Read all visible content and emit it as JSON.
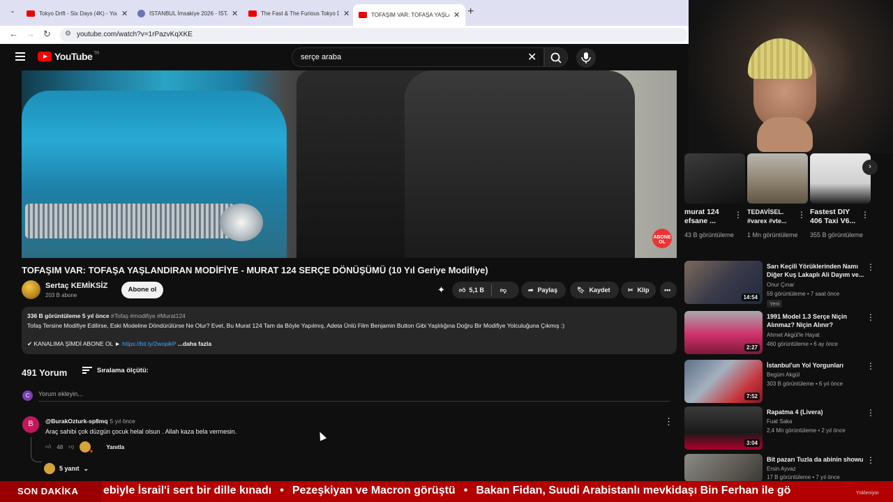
{
  "browser": {
    "tabs": [
      {
        "title": "Tokyo Drift - Six Days (4K) - You",
        "active": false
      },
      {
        "title": "İSTANBUL İmsakiye 2026 - İSTA",
        "active": false
      },
      {
        "title": "The Fast & The Furious Tokyo D",
        "active": false
      },
      {
        "title": "TOFAŞIM VAR: TOFAŞA YAŞLAN",
        "active": true
      }
    ],
    "url": "youtube.com/watch?v=1rPazvKqXKE"
  },
  "header": {
    "logo_text": "YouTube",
    "region": "TR",
    "search_value": "serçe araba"
  },
  "video": {
    "title": "TOFAŞIM VAR: TOFAŞA YAŞLANDIRAN MODİFİYE - MURAT 124 SERÇE DÖNÜŞÜMÜ (10 Yıl Geriye Modifiye)",
    "overlay_badge": "ABONE OL",
    "channel_name": "Sertaç KEMİKSİZ",
    "subscribers": "203 B abone",
    "subscribe_label": "Abone ol",
    "likes": "5,1 B",
    "share_label": "Paylaş",
    "save_label": "Kaydet",
    "clip_label": "Klip"
  },
  "description": {
    "views_time": "336 B görüntüleme  5 yıl önce",
    "tags": "#Tofaş #modifiye #Murat124",
    "line1": "Tofaş Tersine Modifiye Edilirse, Eski Modeline Döndürülürse Ne Olur? Evet, Bu Murat 124 Tam da Böyle Yapılmış, Adeta Ünlü Film Benjamin Button Gibi Yaşlılığına Doğru Bir Modifiye Yolculuğuna Çıkmış :)",
    "line2_prefix": "✔ KANALIMA ŞİMDİ ABONE OL ►",
    "line2_link": "https://bit.ly/2wopikP",
    "more_label": "...daha fazla"
  },
  "comments": {
    "count": "491 Yorum",
    "sort_label": "Sıralama ölçütü:",
    "my_initial": "C",
    "add_placeholder": "Yorum ekleyin...",
    "items": [
      {
        "initial": "B",
        "author": "@BurakOzturk-sp8mq",
        "time": "5 yıl önce",
        "text": "Araç sahibi çok düzgün çocuk helal olsun . Allah kaza bela vermesin.",
        "likes": "48",
        "reply_label": "Yanıtla",
        "replies_label": "5 yanıt"
      }
    ]
  },
  "shorts": [
    {
      "title": "murat 124 efsane ...",
      "views": "43 B görüntüleme"
    },
    {
      "title": "TEDAVİSEL. #varex #vte...",
      "views": "1 Mn görüntüleme"
    },
    {
      "title": "Fastest DIY 406 Taxi V6...",
      "views": "355 B görüntüleme"
    }
  ],
  "recommendations": [
    {
      "title": "Sarı Keçili Yörüklerinden Namı Diğer Kuş Lakaplı Ali Dayım ve...",
      "channel": "Onur Çınar",
      "views": "59 görüntüleme  •  7 saat önce",
      "duration": "14:54",
      "badge": "Yeni"
    },
    {
      "title": "1991 Model 1.3 Serçe Niçin Alınmaz? Niçin Alınır?",
      "channel": "Ahmet Akgül'le Hayat",
      "views": "460 görüntüleme  •  6 ay önce",
      "duration": "2:27"
    },
    {
      "title": "İstanbul'un Yol Yorgunları",
      "channel": "Begüm Akgül",
      "views": "303 B görüntüleme  •  6 yıl önce",
      "duration": "7:52"
    },
    {
      "title": "Rapatma 4 (Livera)",
      "channel": "Fuat Saka",
      "views": "2,4 Mn görüntüleme  •  2 yıl önce",
      "duration": "3:04"
    },
    {
      "title": "Bit pazarı Tuzla da abinin showu",
      "channel": "Ersin Ayvaz",
      "views": "17 B görüntüleme  •  7 yıl önce",
      "duration": ""
    }
  ],
  "ticker": {
    "label": "SON DAKİKA",
    "items": [
      "ebiyle İsrail'i sert bir dille kınadı",
      "Pezeşkiyan ve Macron görüştü",
      "Bakan Fidan, Suudi Arabistanlı mevkidaşı Bin Ferhan ile gö"
    ],
    "watermark": "Yükleniyor"
  },
  "colors": {
    "brand_red": "#ff0000",
    "link": "#3ea6ff",
    "ticker_bg": "#b30000"
  }
}
